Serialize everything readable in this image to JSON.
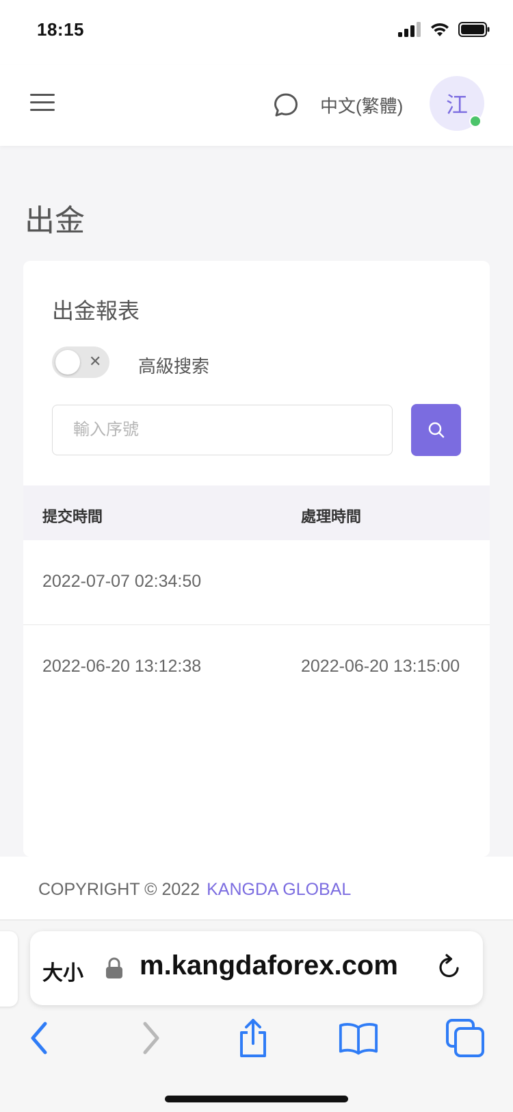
{
  "status_bar": {
    "time": "18:15"
  },
  "header": {
    "language": "中文(繁體)",
    "avatar_initial": "江"
  },
  "page": {
    "title": "出金"
  },
  "report": {
    "title": "出金報表",
    "advanced_search_label": "高級搜索",
    "toggle_state": "off",
    "search_placeholder": "輸入序號",
    "columns": [
      "提交時間",
      "處理時間"
    ],
    "rows": [
      {
        "submitted": "2022-07-07 02:34:50",
        "processed": ""
      },
      {
        "submitted": "2022-06-20 13:12:38",
        "processed": "2022-06-20 13:15:00"
      }
    ]
  },
  "footer": {
    "copyright": "COPYRIGHT © 2022",
    "brand": "KANGDA GLOBAL"
  },
  "browser": {
    "text_size_label": "大小",
    "url": "m.kangdaforex.com"
  },
  "colors": {
    "accent": "#7b6ce0",
    "online": "#4cc46a",
    "ios_blue": "#2f7cf6"
  }
}
